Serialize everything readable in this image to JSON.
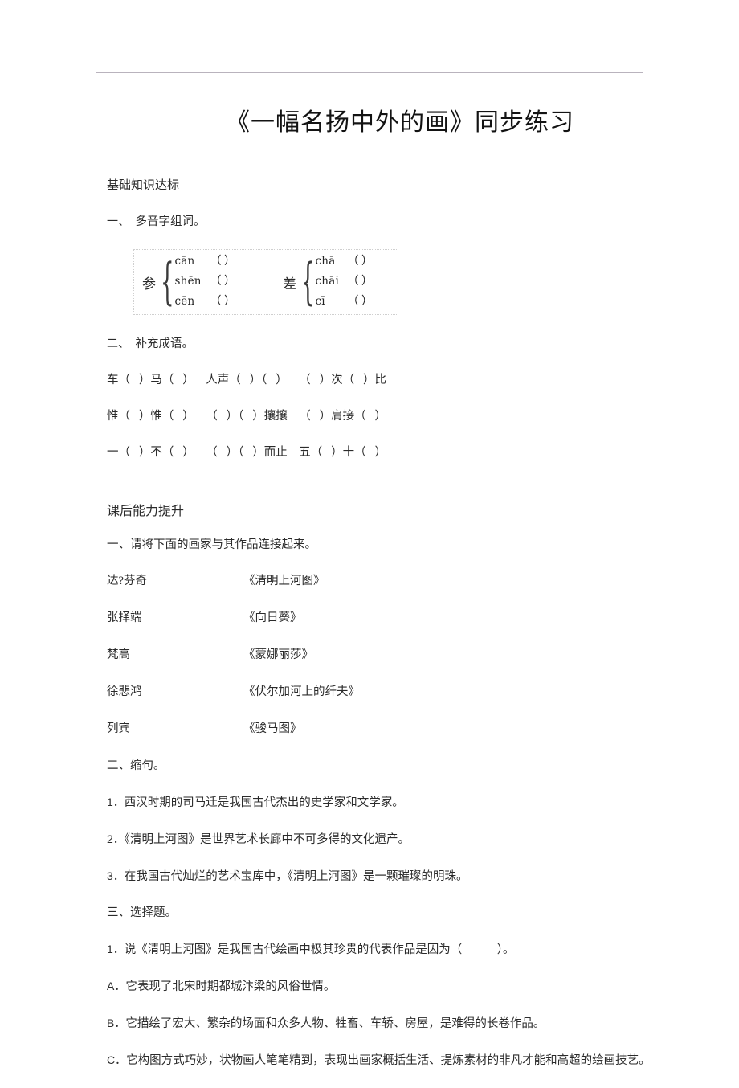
{
  "document": {
    "title": "《一幅名扬中外的画》同步练习",
    "sections": [
      {
        "heading": "基础知识达标"
      },
      {
        "heading": "课后能力提升"
      }
    ]
  },
  "section1": {
    "heading": "基础知识达标",
    "q1": {
      "label": "一、",
      "text": "多音字组词。",
      "pinyin_table": {
        "groups": [
          {
            "char": "参",
            "rows": [
              {
                "pinyin": "cān",
                "blank": "（          ）"
              },
              {
                "pinyin": "shēn",
                "blank": "（          ）"
              },
              {
                "pinyin": "cēn",
                "blank": "（          ）"
              }
            ]
          },
          {
            "char": "差",
            "rows": [
              {
                "pinyin": "chā",
                "blank": "（          ）"
              },
              {
                "pinyin": "chāi",
                "blank": "（          ）"
              },
              {
                "pinyin": "cī",
                "blank": "（          ）"
              }
            ]
          }
        ]
      }
    },
    "q2": {
      "label": "二、",
      "text": "补充成语。",
      "lines": [
        "车（   ）马（   ）    人声（   ）（   ）    （   ）次（   ）比",
        "惟（   ）惟（   ）    （   ）（   ）攘攘    （   ）肩接（   ）",
        "一（   ）不（   ）    （   ）（   ）而止    五（   ）十（   ）"
      ]
    }
  },
  "section2": {
    "heading": "课后能力提升",
    "q1": {
      "label": "一、",
      "text": "请将下面的画家与其作品连接起来。",
      "pairs": [
        {
          "painter": "达?芬奇",
          "work": "《清明上河图》"
        },
        {
          "painter": "张择端",
          "work": "《向日葵》"
        },
        {
          "painter": "梵高",
          "work": "《蒙娜丽莎》"
        },
        {
          "painter": "徐悲鸿",
          "work": "《伏尔加河上的纤夫》"
        },
        {
          "painter": "列宾",
          "work": "《骏马图》"
        }
      ]
    },
    "q2": {
      "label": "二、",
      "text": "缩句。",
      "items": [
        {
          "num": "1．",
          "text": "西汉时期的司马迁是我国古代杰出的史学家和文学家。"
        },
        {
          "num": "2．",
          "text": "《清明上河图》是世界艺术长廊中不可多得的文化遗产。"
        },
        {
          "num": "3．",
          "text": "在我国古代灿烂的艺术宝库中，《清明上河图》是一颗璀璨的明珠。"
        }
      ]
    },
    "q3": {
      "label": "三、",
      "text": "选择题。",
      "question": {
        "num": "1．",
        "stem": "说《清明上河图》是我国古代绘画中极其珍贵的代表作品是因为（            ）。"
      },
      "options": [
        {
          "key": "A．",
          "text": "它表现了北宋时期都城汴梁的风俗世情。"
        },
        {
          "key": "B．",
          "text": "它描绘了宏大、繁杂的场面和众多人物、牲畜、车轿、房屋，是难得的长卷作品。"
        },
        {
          "key": "C．",
          "text": "它构图方式巧妙，状物画人笔笔精到，表现出画家概括生活、提炼素材的非凡才能和高超的绘画技艺。"
        }
      ]
    }
  }
}
